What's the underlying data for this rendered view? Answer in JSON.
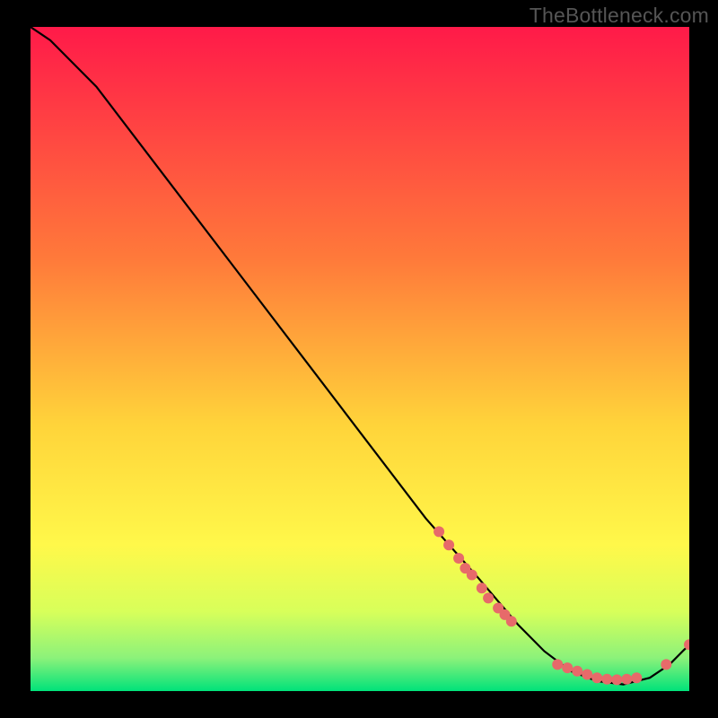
{
  "watermark": "TheBottleneck.com",
  "colors": {
    "bg": "#000000",
    "grad_top": "#ff1a49",
    "grad_mid1": "#ff7a3a",
    "grad_mid2": "#ffd43a",
    "grad_low1": "#fff84a",
    "grad_low2": "#d8ff5a",
    "grad_low3": "#8cf27a",
    "grad_bottom": "#00e27a",
    "curve": "#000000",
    "marker": "#e76a6a"
  },
  "chart_data": {
    "type": "line",
    "title": "",
    "xlabel": "",
    "ylabel": "",
    "xlim": [
      0,
      100
    ],
    "ylim": [
      0,
      100
    ],
    "curve": {
      "x": [
        0,
        3,
        6,
        10,
        20,
        30,
        40,
        50,
        60,
        68,
        74,
        78,
        82,
        86,
        90,
        94,
        97,
        100
      ],
      "y": [
        100,
        98,
        95,
        91,
        78,
        65,
        52,
        39,
        26,
        17,
        10,
        6,
        3,
        1.5,
        1,
        2,
        4,
        7
      ]
    },
    "markers": [
      {
        "x": 62.0,
        "y": 24.0
      },
      {
        "x": 63.5,
        "y": 22.0
      },
      {
        "x": 65.0,
        "y": 20.0
      },
      {
        "x": 66.0,
        "y": 18.5
      },
      {
        "x": 67.0,
        "y": 17.5
      },
      {
        "x": 68.5,
        "y": 15.5
      },
      {
        "x": 69.5,
        "y": 14.0
      },
      {
        "x": 71.0,
        "y": 12.5
      },
      {
        "x": 72.0,
        "y": 11.5
      },
      {
        "x": 73.0,
        "y": 10.5
      },
      {
        "x": 80.0,
        "y": 4.0
      },
      {
        "x": 81.5,
        "y": 3.5
      },
      {
        "x": 83.0,
        "y": 3.0
      },
      {
        "x": 84.5,
        "y": 2.5
      },
      {
        "x": 86.0,
        "y": 2.0
      },
      {
        "x": 87.5,
        "y": 1.8
      },
      {
        "x": 89.0,
        "y": 1.7
      },
      {
        "x": 90.5,
        "y": 1.8
      },
      {
        "x": 92.0,
        "y": 2.0
      },
      {
        "x": 96.5,
        "y": 4.0
      },
      {
        "x": 100.0,
        "y": 7.0
      }
    ]
  }
}
